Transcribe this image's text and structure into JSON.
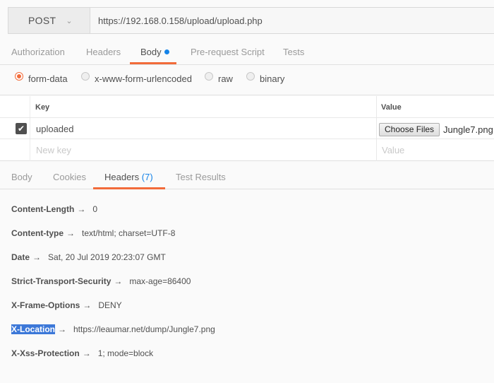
{
  "request": {
    "method": "POST",
    "url": "https://192.168.0.158/upload/upload.php"
  },
  "request_tabs": [
    {
      "label": "Authorization"
    },
    {
      "label": "Headers"
    },
    {
      "label": "Body"
    },
    {
      "label": "Pre-request Script"
    },
    {
      "label": "Tests"
    }
  ],
  "body_types": [
    {
      "label": "form-data",
      "selected": true
    },
    {
      "label": "x-www-form-urlencoded",
      "selected": false
    },
    {
      "label": "raw",
      "selected": false
    },
    {
      "label": "binary",
      "selected": false
    }
  ],
  "form_table": {
    "key_header": "Key",
    "value_header": "Value",
    "row": {
      "key": "uploaded",
      "choose_label": "Choose Files",
      "file": "Jungle7.png"
    },
    "new_key_placeholder": "New key",
    "new_value_placeholder": "Value"
  },
  "response_tabs": [
    {
      "label": "Body"
    },
    {
      "label": "Cookies"
    },
    {
      "label": "Headers",
      "count": "(7)"
    },
    {
      "label": "Test Results"
    }
  ],
  "arrow": "→",
  "response_headers": [
    {
      "key": "Content-Length",
      "value": "0"
    },
    {
      "key": "Content-type",
      "value": "text/html; charset=UTF-8"
    },
    {
      "key": "Date",
      "value": "Sat, 20 Jul 2019 20:23:07 GMT"
    },
    {
      "key": "Strict-Transport-Security",
      "value": "max-age=86400"
    },
    {
      "key": "X-Frame-Options",
      "value": "DENY"
    },
    {
      "key": "X-Location",
      "value": "https://leaumar.net/dump/Jungle7.png"
    },
    {
      "key": "X-Xss-Protection",
      "value": "1; mode=block"
    }
  ]
}
